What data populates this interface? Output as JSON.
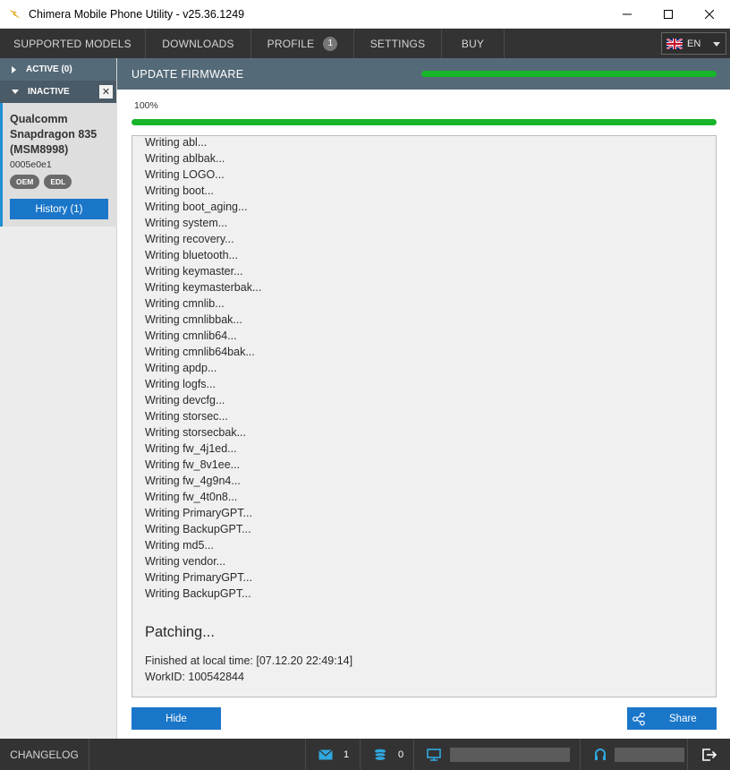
{
  "window": {
    "title": "Chimera Mobile Phone Utility - v25.36.1249"
  },
  "nav": {
    "items": [
      {
        "label": "SUPPORTED MODELS"
      },
      {
        "label": "DOWNLOADS"
      },
      {
        "label": "PROFILE",
        "badge": "1"
      },
      {
        "label": "SETTINGS"
      },
      {
        "label": "BUY"
      }
    ],
    "language": "EN"
  },
  "sidebar": {
    "active_label": "ACTIVE (0)",
    "inactive_label": "INACTIVE",
    "device": {
      "name_line1": "Qualcomm",
      "name_line2": "Snapdragon 835",
      "name_line3": "(MSM8998)",
      "id": "0005e0e1",
      "tags": [
        "OEM",
        "EDL"
      ],
      "history_label": "History (1)"
    }
  },
  "main": {
    "title": "UPDATE FIRMWARE",
    "progress_percent": 100,
    "progress_label": "100%",
    "log_lines": [
      "Writing abl...",
      "Writing ablbak...",
      "Writing LOGO...",
      "Writing boot...",
      "Writing boot_aging...",
      "Writing system...",
      "Writing recovery...",
      "Writing bluetooth...",
      "Writing keymaster...",
      "Writing keymasterbak...",
      "Writing cmnlib...",
      "Writing cmnlibbak...",
      "Writing cmnlib64...",
      "Writing cmnlib64bak...",
      "Writing apdp...",
      "Writing logfs...",
      "Writing devcfg...",
      "Writing storsec...",
      "Writing storsecbak...",
      "Writing fw_4j1ed...",
      "Writing fw_8v1ee...",
      "Writing fw_4g9n4...",
      "Writing fw_4t0n8...",
      "Writing PrimaryGPT...",
      "Writing BackupGPT...",
      "Writing md5...",
      "Writing vendor...",
      "Writing PrimaryGPT...",
      "Writing BackupGPT..."
    ],
    "patching": "Patching...",
    "finished": "Finished at local time: [07.12.20 22:49:14]",
    "workid": "WorkID: 100542844",
    "hide_label": "Hide",
    "share_label": "Share"
  },
  "footer": {
    "changelog": "CHANGELOG",
    "messages_count": "1",
    "credits_count": "0"
  },
  "colors": {
    "accent_blue": "#1a76c9",
    "progress_green": "#17b52a",
    "header_slate": "#556a78",
    "nav_dark": "#333333"
  }
}
